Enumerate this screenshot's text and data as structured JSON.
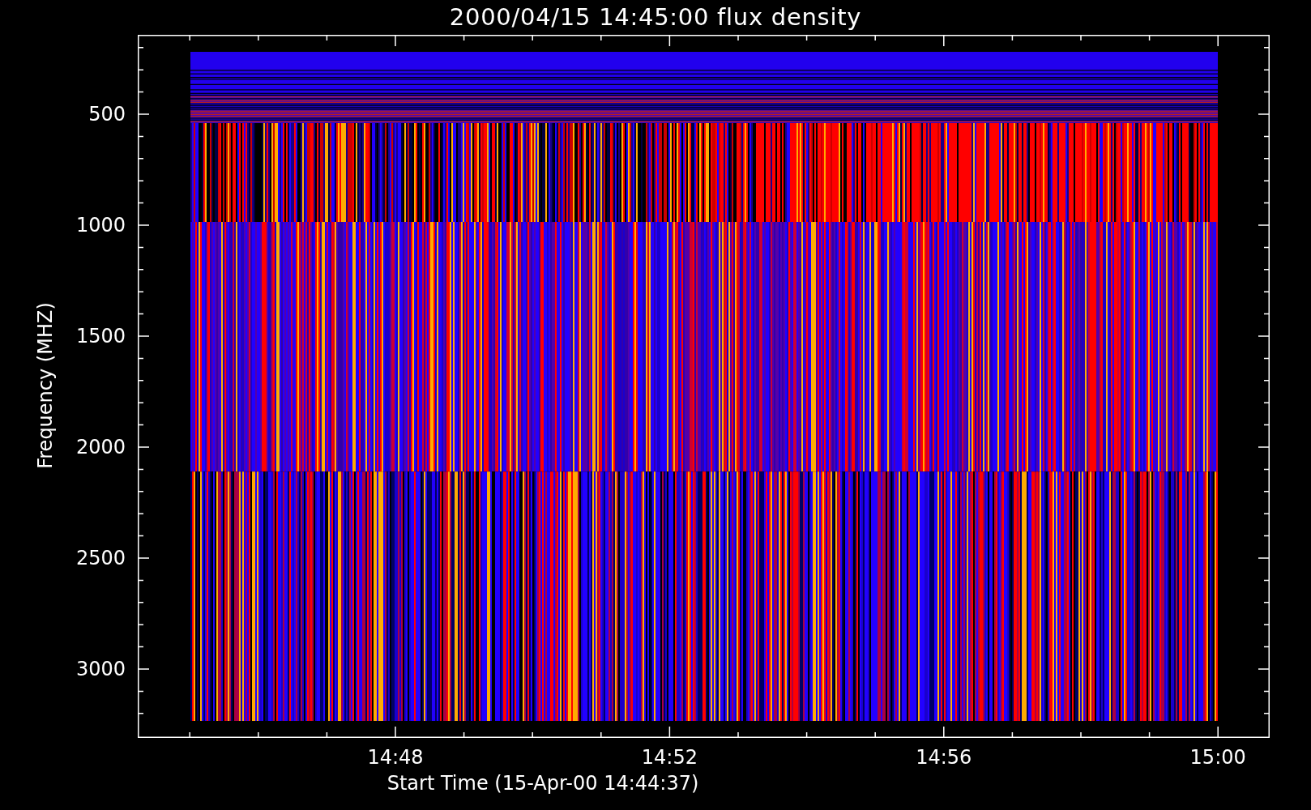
{
  "title": "2000/04/15 14:45:00 flux density",
  "ylabel": "Frequency (MHZ)",
  "xlabel": "Start Time (15-Apr-00 14:44:37)",
  "yticks": [
    "500",
    "1000",
    "1500",
    "2000",
    "2500",
    "3000"
  ],
  "xticks": [
    "14:48",
    "14:52",
    "14:56",
    "15:00"
  ]
}
